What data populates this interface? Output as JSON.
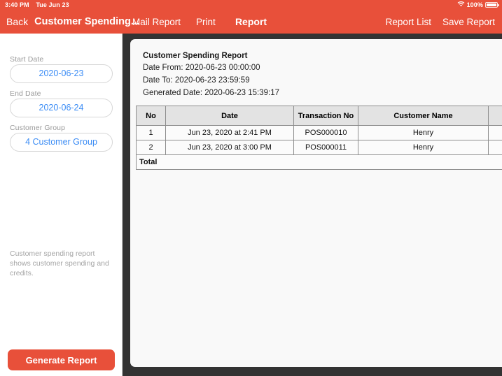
{
  "statusbar": {
    "time": "3:40 PM",
    "date": "Tue Jun 23",
    "battery_percent": "100%",
    "wifi_icon": "wifi-icon",
    "battery_icon": "battery-full-icon"
  },
  "navbar": {
    "back_label": "Back",
    "screen_title": "Customer Spending...",
    "mail_report_label": "Mail Report",
    "print_label": "Print",
    "center_title": "Report",
    "report_list_label": "Report List",
    "save_report_label": "Save Report"
  },
  "sidebar": {
    "start_date_label": "Start Date",
    "start_date_value": "2020-06-23",
    "end_date_label": "End Date",
    "end_date_value": "2020-06-24",
    "customer_group_label": "Customer Group",
    "customer_group_value": "4 Customer Group",
    "description": "Customer spending report shows customer spending and credits.",
    "generate_button_label": "Generate Report"
  },
  "report": {
    "title": "Customer Spending Report",
    "meta": [
      "Date From: 2020-06-23 00:00:00",
      "Date To: 2020-06-23 23:59:59",
      "Generated Date: 2020-06-23 15:39:17"
    ],
    "table": {
      "columns": [
        "No",
        "Date",
        "Transaction No",
        "Customer Name",
        ""
      ],
      "rows": [
        [
          "1",
          "Jun 23, 2020 at 2:41 PM",
          "POS000010",
          "Henry",
          ""
        ],
        [
          "2",
          "Jun 23, 2020 at 3:00 PM",
          "POS000011",
          "Henry",
          ""
        ]
      ],
      "total_label": "Total"
    }
  },
  "colors": {
    "brand_red": "#e8503e",
    "link_blue": "#3b8cf5",
    "viewer_dark": "#333333"
  }
}
